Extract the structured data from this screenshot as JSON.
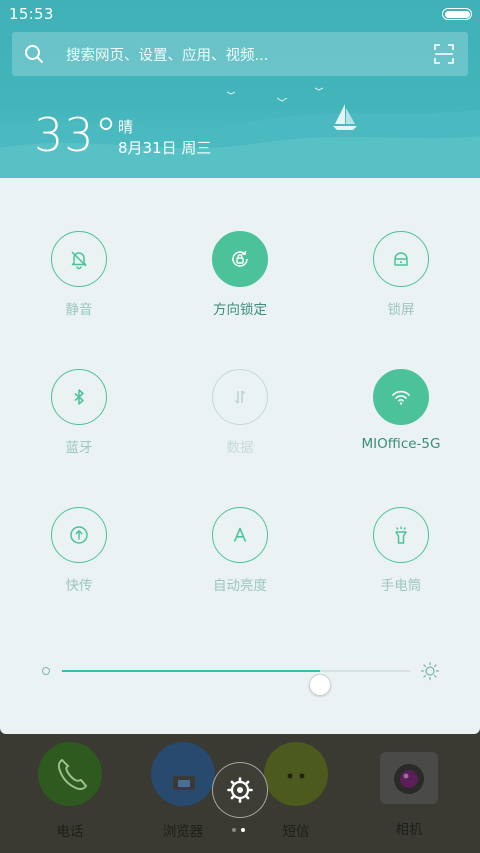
{
  "status": {
    "time": "15:53"
  },
  "search": {
    "placeholder": "搜索网页、设置、应用、视频..."
  },
  "weather": {
    "temperature": "33°",
    "condition": "晴",
    "date": "8月31日 周三"
  },
  "toggles": [
    {
      "label": "静音",
      "icon": "bell-off-icon",
      "state": "inactive"
    },
    {
      "label": "方向锁定",
      "icon": "rotation-lock-icon",
      "state": "active"
    },
    {
      "label": "锁屏",
      "icon": "lock-icon",
      "state": "inactive"
    },
    {
      "label": "蓝牙",
      "icon": "bluetooth-icon",
      "state": "inactive"
    },
    {
      "label": "数据",
      "icon": "mobile-data-icon",
      "state": "disabled"
    },
    {
      "label": "MIOffice-5G",
      "icon": "wifi-icon",
      "state": "active"
    },
    {
      "label": "快传",
      "icon": "quick-transfer-icon",
      "state": "inactive"
    },
    {
      "label": "自动亮度",
      "icon": "auto-brightness-icon",
      "state": "inactive"
    },
    {
      "label": "手电筒",
      "icon": "flashlight-icon",
      "state": "inactive"
    }
  ],
  "brightness": {
    "level": 0.74
  },
  "dock": {
    "apps": [
      {
        "label": "电话",
        "icon": "phone-icon"
      },
      {
        "label": "浏览器",
        "icon": "browser-icon"
      },
      {
        "label": "短信",
        "icon": "messages-icon"
      },
      {
        "label": "相机",
        "icon": "camera-icon"
      }
    ]
  },
  "pager": {
    "pages": 2,
    "current": 2
  },
  "colors": {
    "accent": "#4cc29a",
    "header": "#42b5bb",
    "panel": "#ebf2f3"
  }
}
